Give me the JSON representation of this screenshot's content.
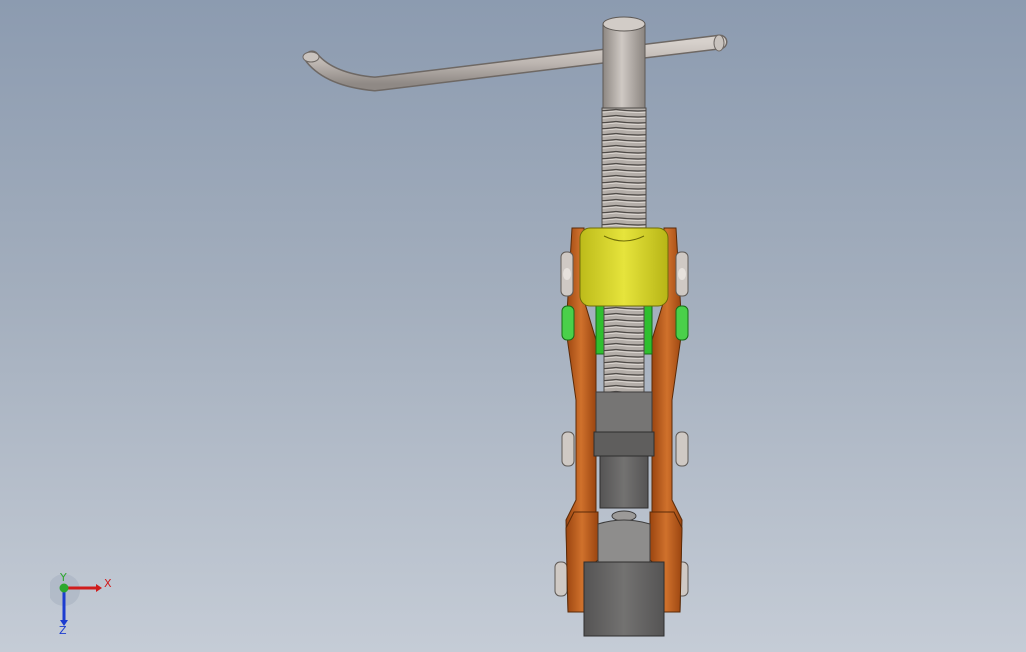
{
  "viewport": {
    "background_top": "#8c9bb0",
    "background_bottom": "#c5ccd6"
  },
  "model": {
    "handle_color": "#bdb6b1",
    "screw_color": "#a9a39e",
    "yoke_color": "#d2d02a",
    "plate_color": "#c0601c",
    "spacer_color": "#2fbf2f",
    "jaw_color": "#6a6968"
  },
  "triad": {
    "x_label": "X",
    "y_label": "Y",
    "z_label": "Z",
    "x_color": "#d01c1c",
    "y_color": "#2ea82e",
    "z_color": "#1c3cd0"
  }
}
